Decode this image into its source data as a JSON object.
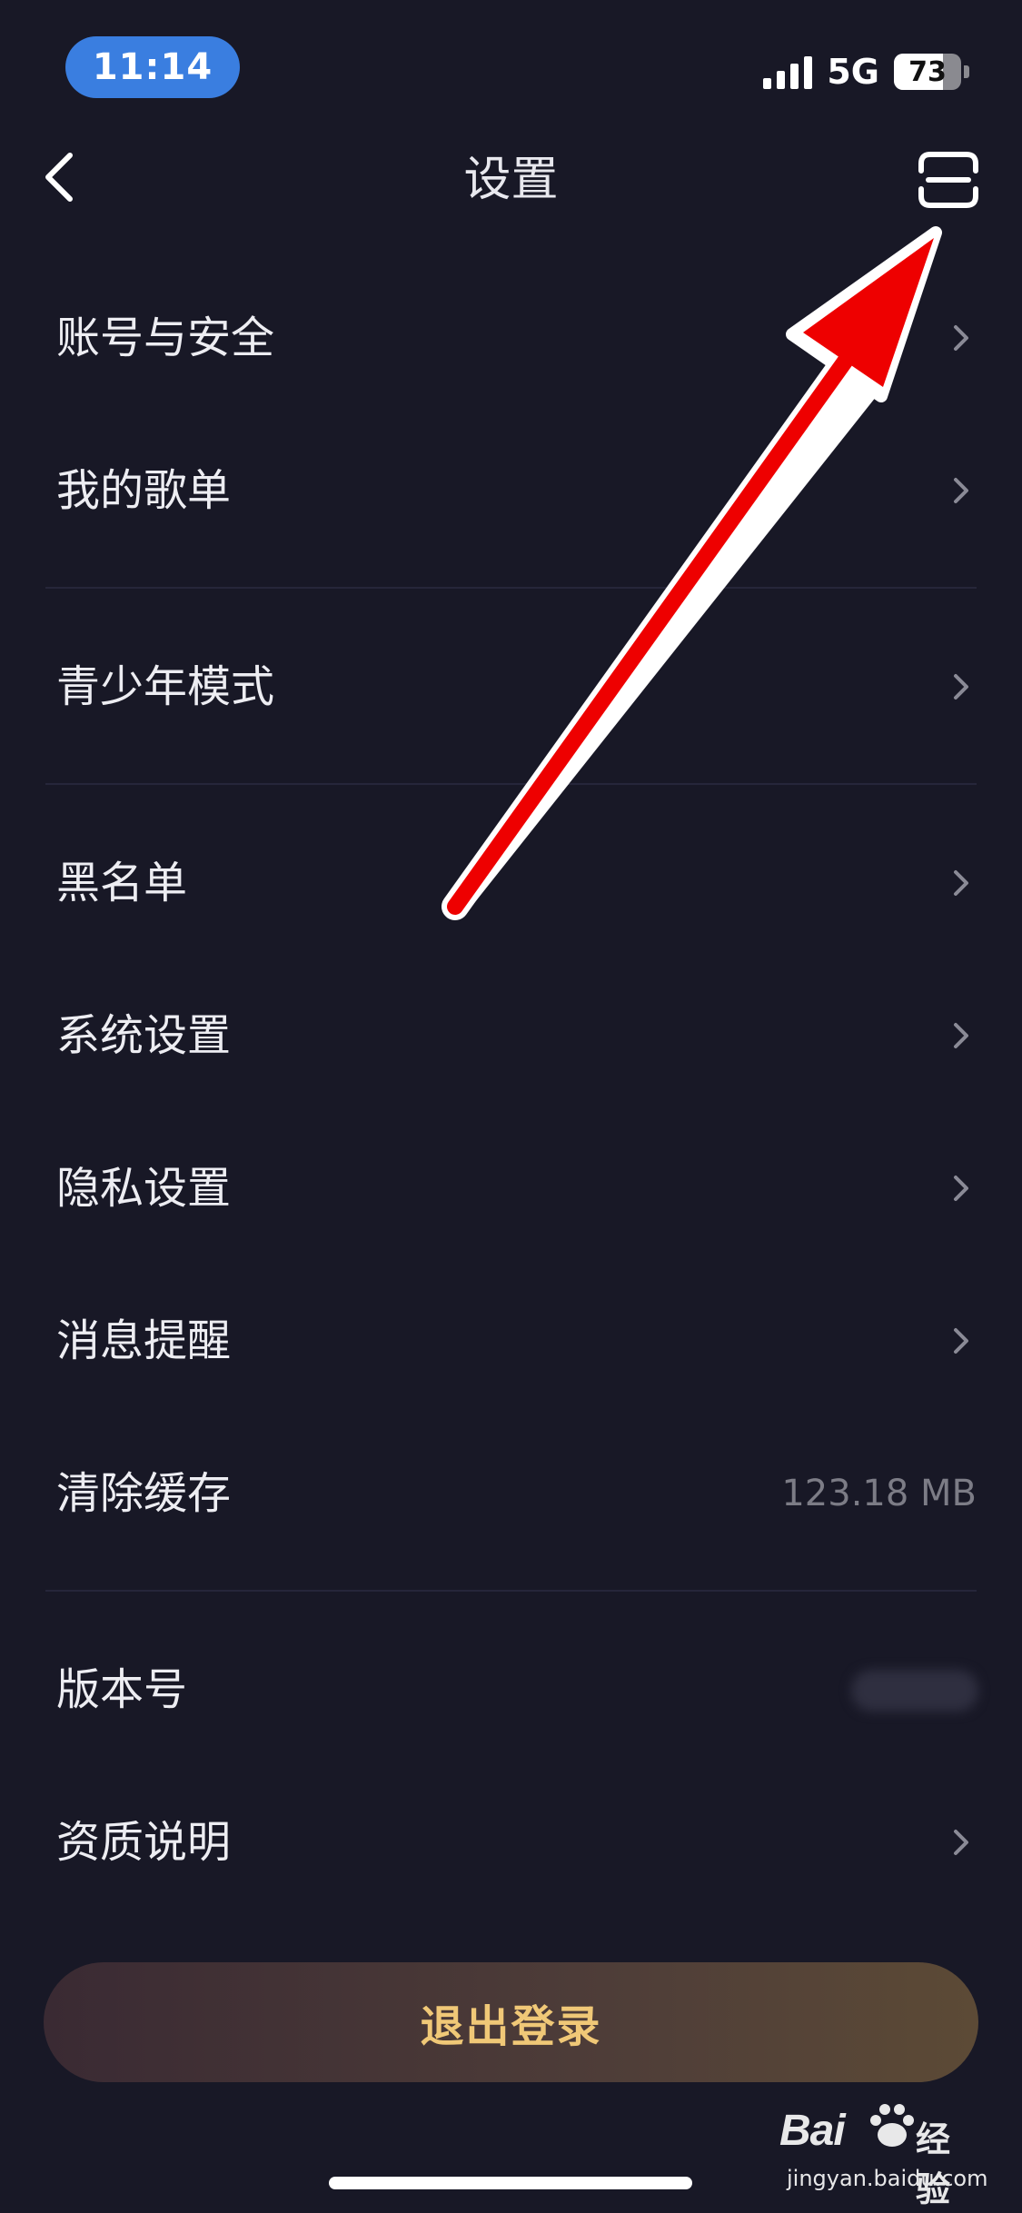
{
  "status_bar": {
    "time": "11:14",
    "network": "5G",
    "battery_level": "73",
    "battery_fraction": 0.73,
    "signal_bars": 4
  },
  "nav": {
    "title": "设置",
    "back_icon": "chevron-left-icon",
    "scan_icon": "scan-icon"
  },
  "settings": {
    "rows": [
      {
        "label": "账号与安全"
      },
      {
        "label": "我的歌单"
      },
      {
        "label": "青少年模式"
      },
      {
        "label": "黑名单"
      },
      {
        "label": "系统设置"
      },
      {
        "label": "隐私设置"
      },
      {
        "label": "消息提醒"
      },
      {
        "label": "清除缓存",
        "value": "123.18 MB"
      },
      {
        "label": "版本号"
      },
      {
        "label": "资质说明"
      }
    ]
  },
  "logout": {
    "label": "退出登录"
  },
  "annotation": {
    "color": "#ee0000",
    "shape": "arrow"
  },
  "watermark": {
    "logo_left": "Bai",
    "logo_right": "经验",
    "url": "jingyan.baidu.com"
  }
}
